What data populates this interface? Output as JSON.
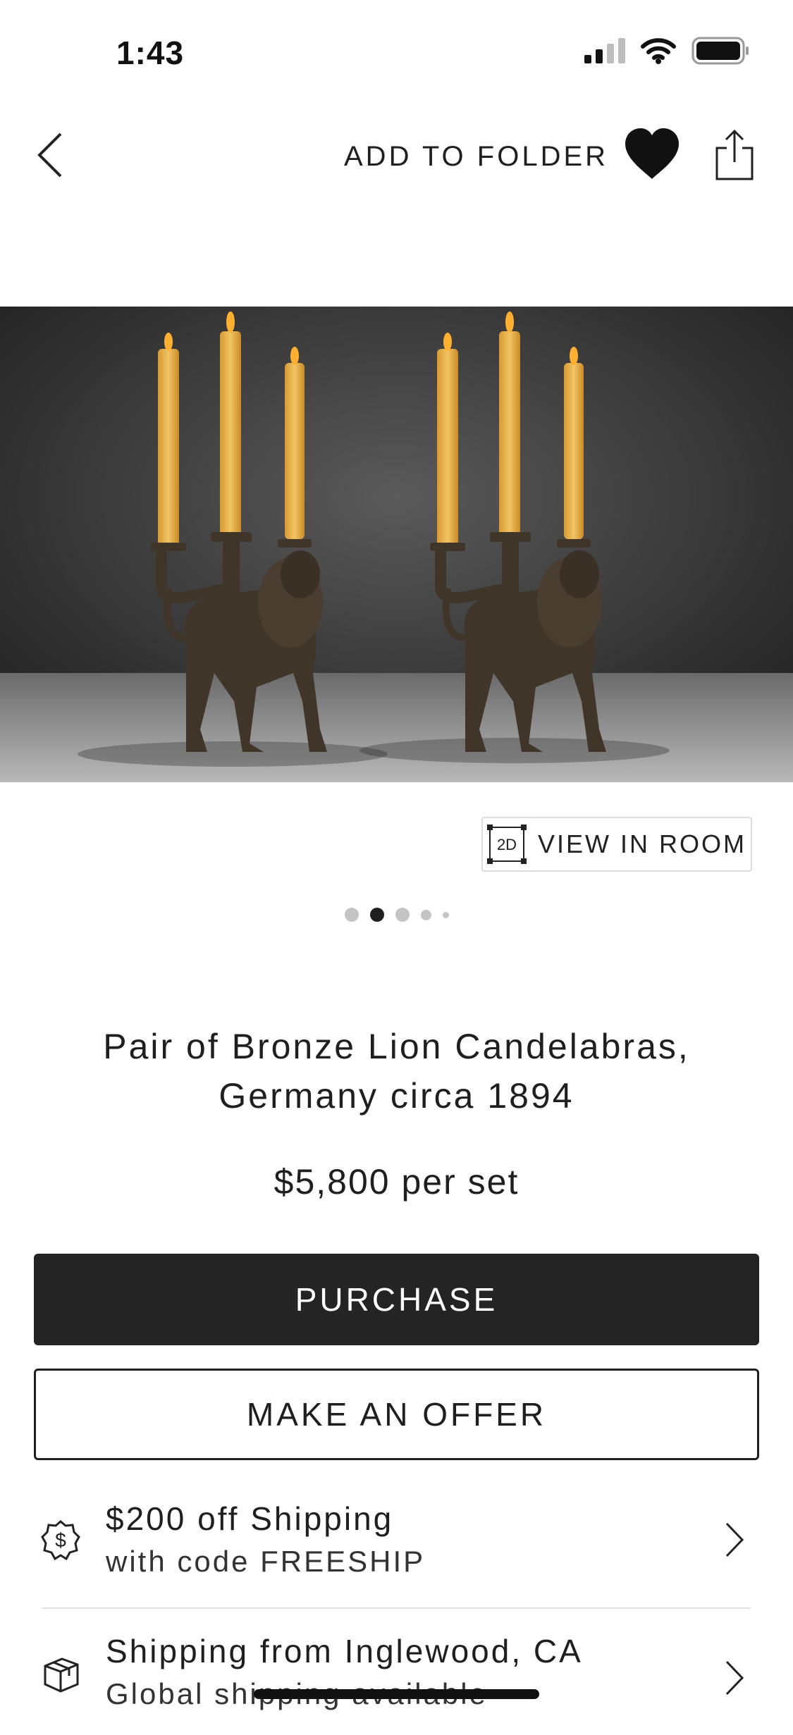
{
  "status_bar": {
    "time": "1:43"
  },
  "nav": {
    "add_to_folder": "ADD TO FOLDER"
  },
  "gallery": {
    "view_in_room_badge": "2D",
    "view_in_room": "VIEW IN ROOM",
    "page_count": 5,
    "active_page": 2
  },
  "product": {
    "title_line1": "Pair of Bronze Lion Candelabras,",
    "title_line2": "Germany circa 1894",
    "price": "$5,800 per set"
  },
  "actions": {
    "purchase": "PURCHASE",
    "make_offer": "MAKE AN OFFER"
  },
  "info_rows": [
    {
      "icon": "dollar-badge-icon",
      "line1": "$200 off Shipping",
      "line2": "with code FREESHIP"
    },
    {
      "icon": "box-icon",
      "line1": "Shipping from Inglewood, CA",
      "line2": "Global shipping available"
    }
  ],
  "colors": {
    "primary_button": "#242424",
    "text": "#1f1f1f",
    "candle": "#e8b04a",
    "bronze": "#3f3529"
  }
}
